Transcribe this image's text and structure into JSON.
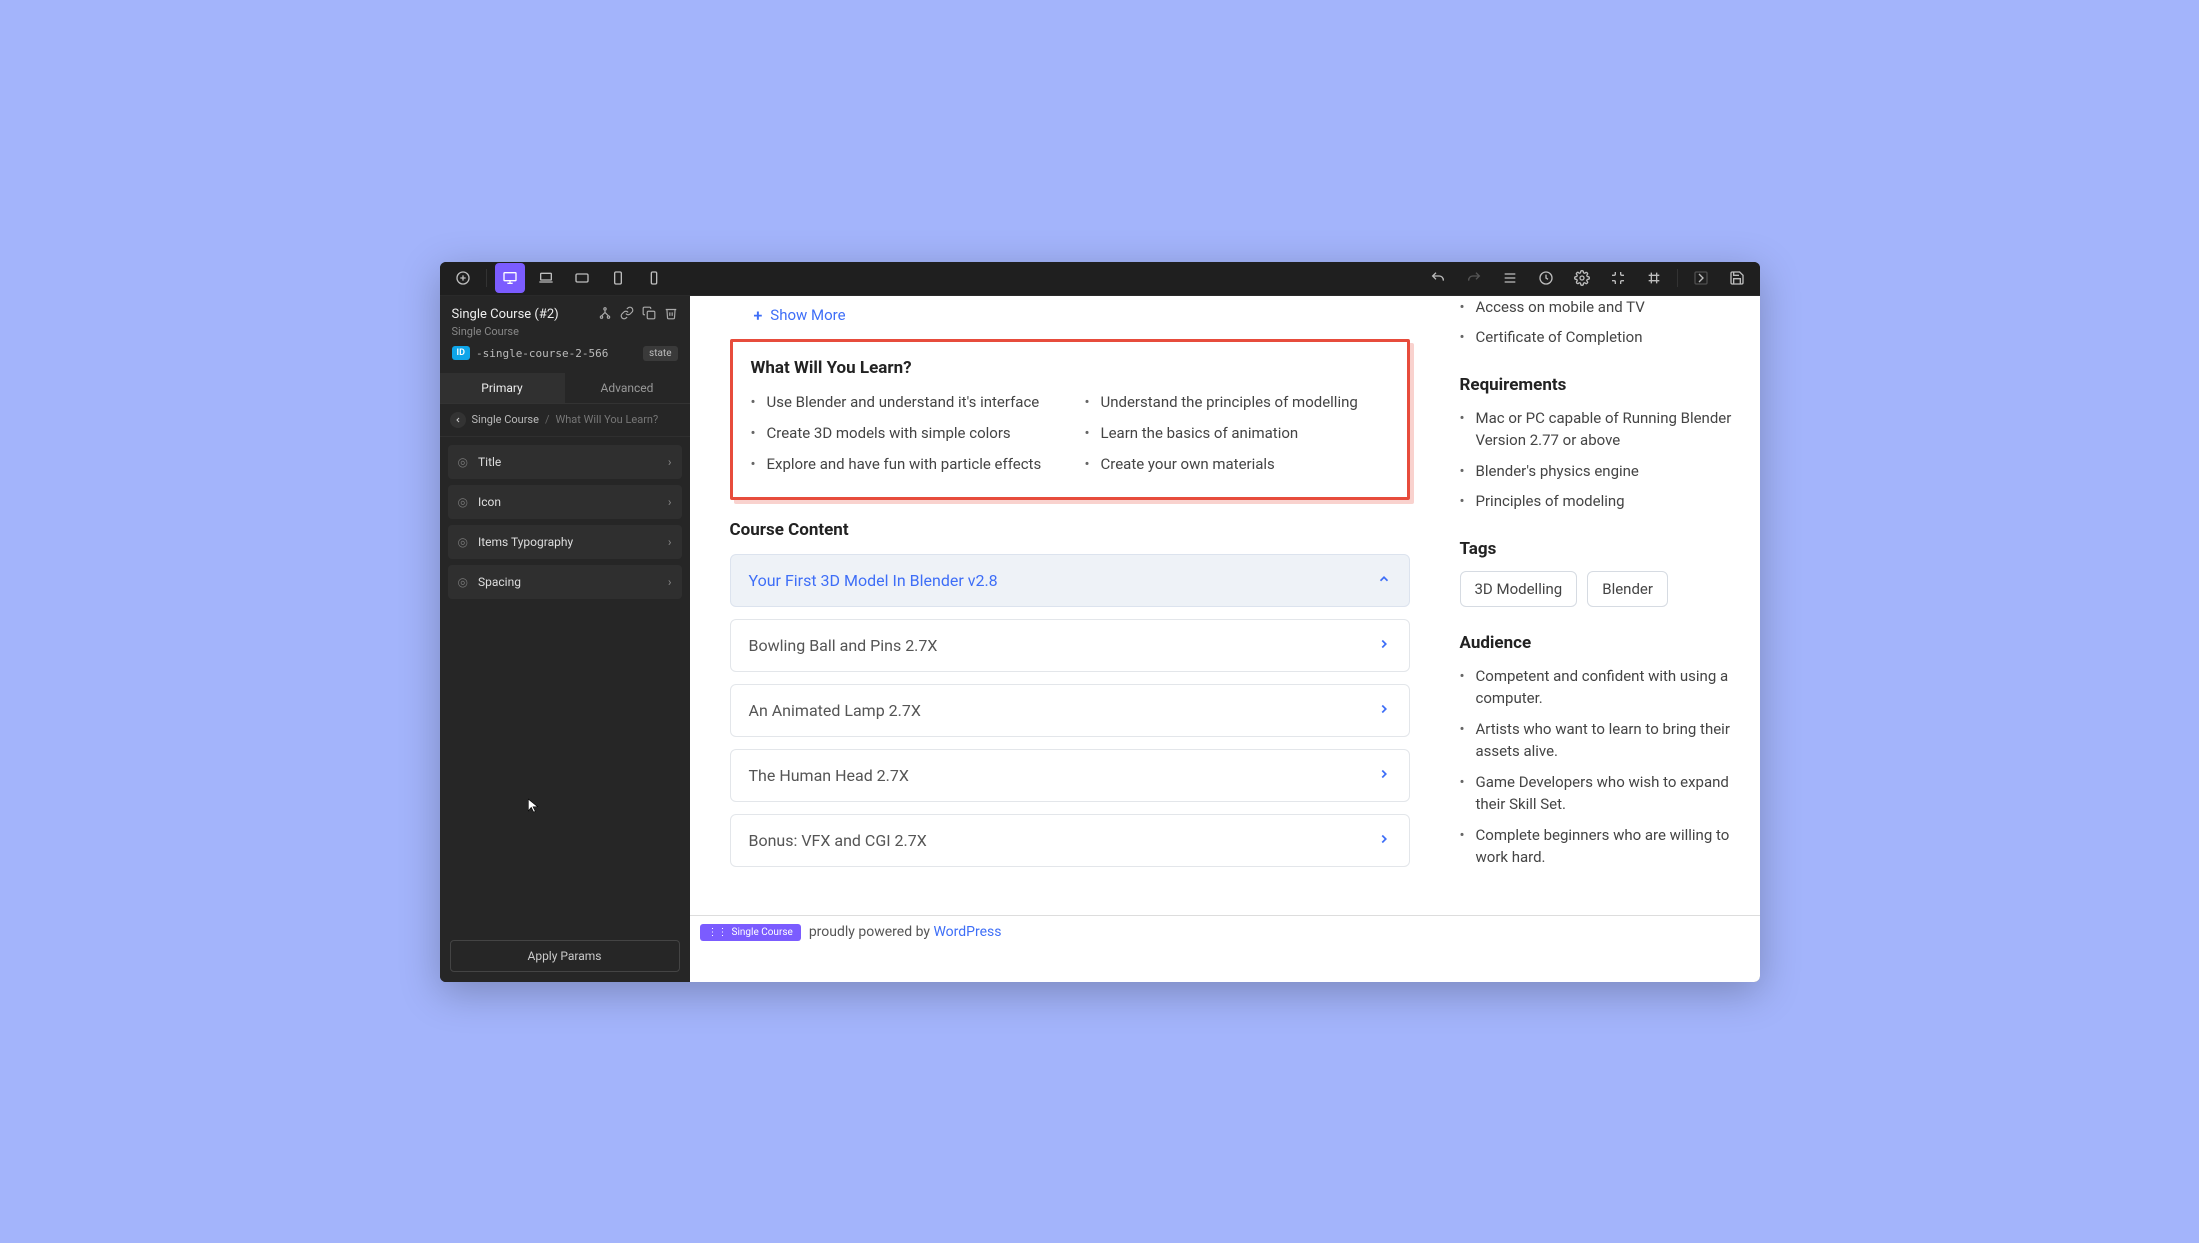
{
  "topbar": {
    "devices": [
      "desktop",
      "laptop",
      "tablet-landscape",
      "tablet-portrait",
      "mobile"
    ],
    "active_device": 0
  },
  "sidebar": {
    "title": "Single Course (#2)",
    "subtitle": "Single Course",
    "id_badge": "ID",
    "id_text": "-single-course-2-566",
    "state_chip": "state",
    "tabs": {
      "primary": "Primary",
      "advanced": "Advanced",
      "active": "primary"
    },
    "crumbs": {
      "root": "Single Course",
      "current": "What Will You Learn?"
    },
    "panels": [
      {
        "label": "Title"
      },
      {
        "label": "Icon"
      },
      {
        "label": "Items Typography"
      },
      {
        "label": "Spacing"
      }
    ],
    "apply_label": "Apply Params"
  },
  "content": {
    "show_more": "Show More",
    "learn": {
      "title": "What Will You Learn?",
      "left": [
        "Use Blender and understand it's interface",
        "Create 3D models with simple colors",
        "Explore and have fun with particle effects"
      ],
      "right": [
        "Understand the principles of modelling",
        "Learn the basics of animation",
        "Create your own materials"
      ]
    },
    "course_content_title": "Course Content",
    "sections": [
      {
        "title": "Your First 3D Model In Blender v2.8",
        "expanded": true
      },
      {
        "title": "Bowling Ball and Pins 2.7X",
        "expanded": false
      },
      {
        "title": "An Animated Lamp 2.7X",
        "expanded": false
      },
      {
        "title": "The Human Head 2.7X",
        "expanded": false
      },
      {
        "title": "Bonus: VFX and CGI 2.7X",
        "expanded": false
      }
    ],
    "features": [
      "Access on mobile and TV",
      "Certificate of Completion"
    ],
    "requirements_title": "Requirements",
    "requirements": [
      "Mac or PC capable of Running Blender Version 2.77 or above",
      "Blender's physics engine",
      "Principles of modeling"
    ],
    "tags_title": "Tags",
    "tags": [
      "3D Modelling",
      "Blender"
    ],
    "audience_title": "Audience",
    "audience": [
      "Competent and confident with using a computer.",
      "Artists who want to learn to bring their assets alive.",
      "Game Developers who wish to expand their Skill Set.",
      "Complete beginners who are willing to work hard."
    ]
  },
  "footer": {
    "badge": "Single Course",
    "text": "proudly powered by ",
    "link": "WordPress"
  }
}
